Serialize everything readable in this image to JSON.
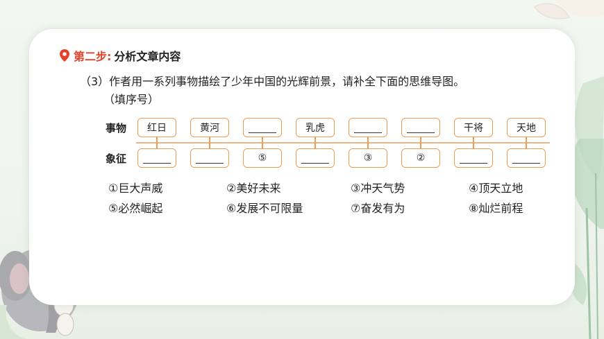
{
  "step": {
    "label": "第二步:",
    "title": "分析文章内容"
  },
  "question": {
    "line1": "（3）作者用一系列事物描绘了少年中国的光辉前景，请补全下面的思维导图。",
    "line2": "（填序号）"
  },
  "diagram": {
    "row1_label": "事物",
    "row2_label": "象征",
    "things": [
      "红日",
      "黄河",
      "",
      "乳虎",
      "",
      "",
      "干将",
      "天地"
    ],
    "symbols": [
      "",
      "",
      "⑤",
      "",
      "③",
      "②",
      "",
      ""
    ]
  },
  "options": [
    "①巨大声威",
    "②美好未来",
    "③冲天气势",
    "④顶天立地",
    "⑤必然崛起",
    "⑥发展不可限量",
    "⑦奋发有为",
    "⑧灿烂前程"
  ],
  "colors": {
    "accent": "#e8412a",
    "box_border": "#f29c53",
    "line": "#f0b482"
  },
  "icons": {
    "step_marker": "location-pin-icon"
  }
}
